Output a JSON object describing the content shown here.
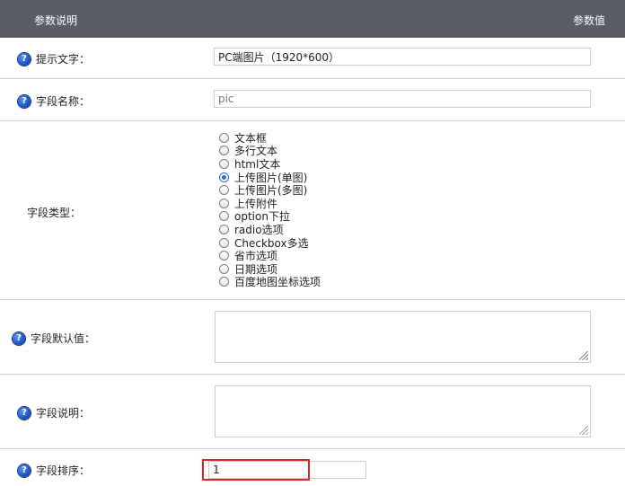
{
  "header": {
    "left_label": "参数说明",
    "right_label": "参数值"
  },
  "fields": {
    "hint_text": {
      "label": "提示文字：",
      "value": "PC端图片（1920*600）"
    },
    "field_name": {
      "label": "字段名称：",
      "placeholder": "pic"
    },
    "field_type": {
      "label": "字段类型：",
      "options": [
        "文本框",
        "多行文本",
        "html文本",
        "上传图片(单图)",
        "上传图片(多图)",
        "上传附件",
        "option下拉",
        "radio选项",
        "Checkbox多选",
        "省市选项",
        "日期选项",
        "百度地图坐标选项"
      ],
      "selected": "上传图片(单图)"
    },
    "default_value": {
      "label": "字段默认值：",
      "value": ""
    },
    "description": {
      "label": "字段说明：",
      "value": ""
    },
    "sort_order": {
      "label": "字段排序：",
      "value": "1"
    }
  },
  "icons": {
    "help": "question-circle-icon"
  },
  "colors": {
    "header_bg": "#5a5c68",
    "highlight": "#e02424",
    "radio_checked": "#1e6fe0"
  }
}
